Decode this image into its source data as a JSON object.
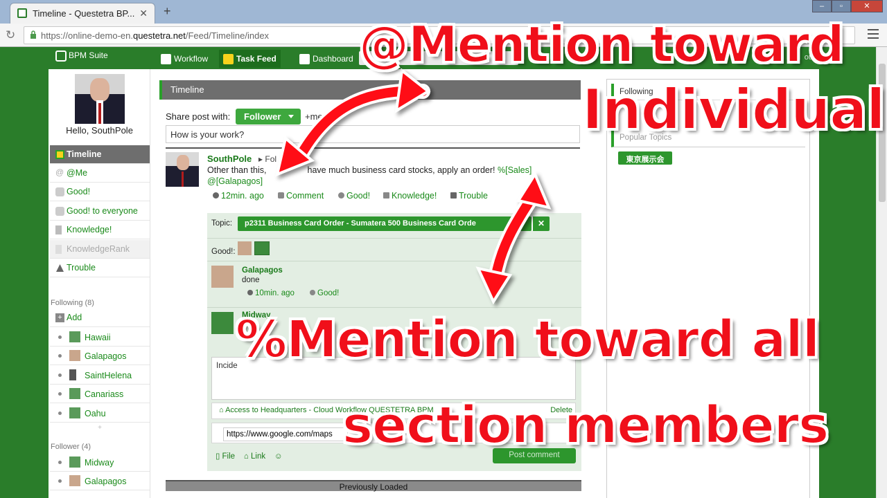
{
  "browser": {
    "tab_title": "Timeline - Questetra BP...",
    "tab_close": "✕",
    "new_tab": "+",
    "url_prefix": "https://online-demo-en.",
    "url_domain": "questetra.net",
    "url_path": "/Feed/Timeline/index"
  },
  "app": {
    "logo_text": "BPM Suite",
    "nav": [
      {
        "label": "Workflow",
        "icon": "workflow-icon"
      },
      {
        "label": "Task Feed",
        "icon": "task-feed-icon"
      },
      {
        "label": "Dashboard",
        "icon": "dashboard-icon"
      }
    ],
    "header_right": "out"
  },
  "left": {
    "hello": "Hello, SouthPole",
    "menu": [
      {
        "label": "Timeline",
        "icon": "timeline-icon",
        "state": "active"
      },
      {
        "label": "@Me",
        "icon": "at-icon",
        "state": ""
      },
      {
        "label": "Good!",
        "icon": "thumb-icon",
        "state": ""
      },
      {
        "label": "Good! to everyone",
        "icon": "thumb-icon",
        "state": ""
      },
      {
        "label": "Knowledge!",
        "icon": "book-icon",
        "state": ""
      },
      {
        "label": "KnowledgeRank",
        "icon": "rank-icon",
        "state": "disabled"
      },
      {
        "label": "Trouble",
        "icon": "warning-icon",
        "state": ""
      }
    ],
    "following_title": "Following (8)",
    "add_label": "Add",
    "following": [
      "Hawaii",
      "Galapagos",
      "SaintHelena",
      "Canariass",
      "Oahu"
    ],
    "more": "+",
    "follower_title": "Follower (4)",
    "followers": [
      "Midway",
      "Galapagos"
    ]
  },
  "main": {
    "panel_title": "Timeline",
    "share_label": "Share post with:",
    "share_target": "Follower",
    "mention_link": "+men",
    "input_value": "How is your work?",
    "post": {
      "author": "SouthPole",
      "follows": "Fol",
      "text_a": "Other than this,",
      "text_b": "have much business card stocks, apply an order!",
      "tag_section": "%[Sales]",
      "tag_user": "@[Galapagos]",
      "time": "12min. ago",
      "actions": [
        "Comment",
        "Good!",
        "Knowledge!",
        "Trouble"
      ]
    },
    "thread": {
      "topic_label": "Topic:",
      "topic": "p2311 Business Card Order - Sumatera 500 Business Card Orde",
      "topic_close": "✕",
      "good_label": "Good!:",
      "comments": [
        {
          "name": "Galapagos",
          "text": "done",
          "time": "10min. ago",
          "good": "Good!"
        },
        {
          "name": "Midway",
          "text": "",
          "time": "",
          "good": ""
        }
      ],
      "comment_draft": "Incide",
      "attachment": "Access to Headquarters - Cloud Workflow QUESTETRA BPM",
      "attachment_right": "Delete",
      "link_value": "https://www.google.com/maps",
      "tools": [
        "File",
        "Link"
      ],
      "post_button": "Post comment"
    },
    "previously_loaded": "Previously Loaded"
  },
  "right": {
    "following_head": "Following",
    "popular_head": "Popular Topics",
    "tag": "東京展示会"
  },
  "annotations": {
    "top": "@Mention toward\nIndividual",
    "top_line1": "@Mention toward",
    "top_line2": "Individual",
    "bottom_line1": "%Mention toward all",
    "bottom_line2": "section members",
    "arrow_color": "#ff0a14"
  }
}
